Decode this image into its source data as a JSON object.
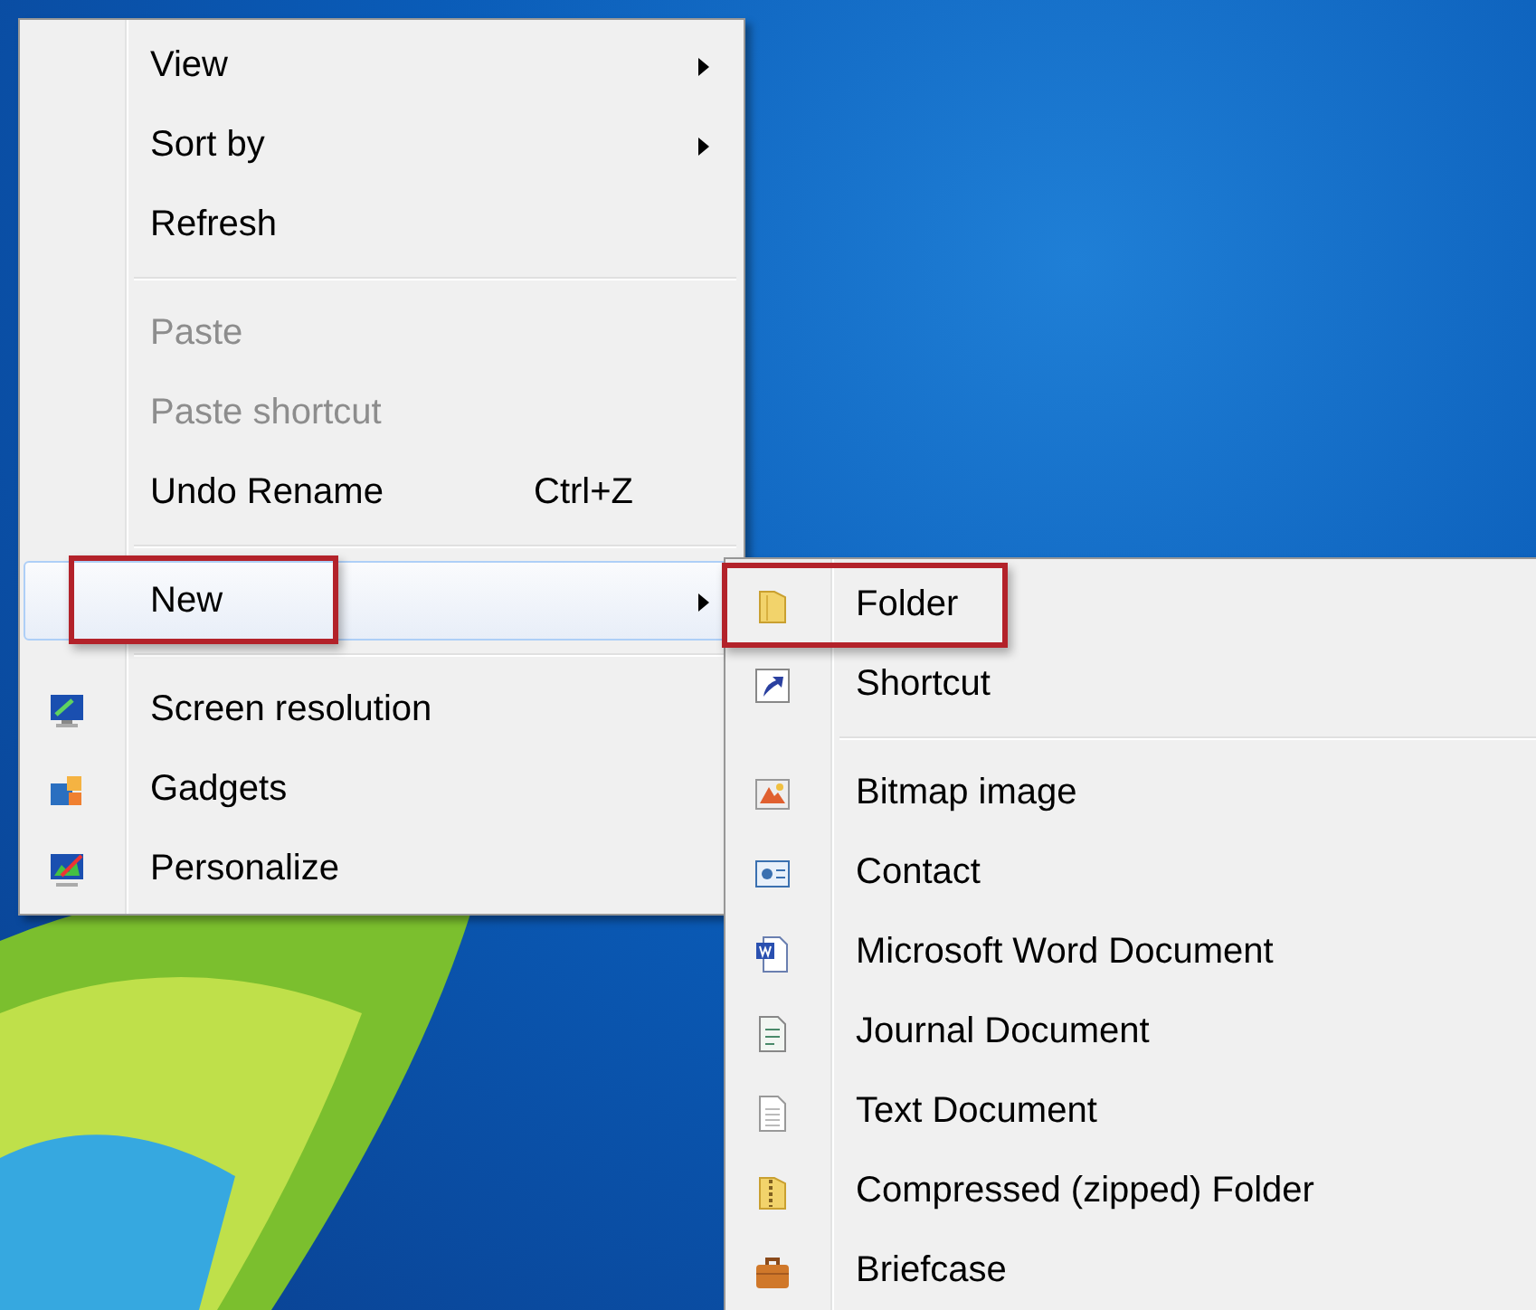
{
  "context_menu": {
    "items": [
      {
        "kind": "item",
        "label": "View",
        "submenu": true,
        "disabled": false,
        "selected": false,
        "marked": false
      },
      {
        "kind": "item",
        "label": "Sort by",
        "submenu": true,
        "disabled": false,
        "selected": false,
        "marked": false
      },
      {
        "kind": "item",
        "label": "Refresh",
        "submenu": false,
        "disabled": false,
        "selected": false,
        "marked": false
      },
      {
        "kind": "separator"
      },
      {
        "kind": "item",
        "label": "Paste",
        "submenu": false,
        "disabled": true,
        "selected": false,
        "marked": false
      },
      {
        "kind": "item",
        "label": "Paste shortcut",
        "submenu": false,
        "disabled": true,
        "selected": false,
        "marked": false
      },
      {
        "kind": "item",
        "label": "Undo Rename",
        "shortcut": "Ctrl+Z",
        "submenu": false,
        "disabled": false,
        "selected": false,
        "marked": false
      },
      {
        "kind": "separator"
      },
      {
        "kind": "item",
        "label": "New",
        "submenu": true,
        "disabled": false,
        "selected": true,
        "marked": true
      },
      {
        "kind": "separator"
      },
      {
        "kind": "monitor",
        "label": "Screen resolution",
        "submenu": false,
        "disabled": false,
        "selected": false,
        "marked": false
      },
      {
        "kind": "gadgets",
        "label": "Gadgets",
        "submenu": false,
        "disabled": false,
        "selected": false,
        "marked": false
      },
      {
        "kind": "personalize",
        "label": "Personalize",
        "submenu": false,
        "disabled": false,
        "selected": false,
        "marked": false
      }
    ]
  },
  "new_submenu": {
    "items": [
      {
        "kind": "folder",
        "label": "Folder",
        "submenu": false,
        "disabled": false,
        "selected": false,
        "marked": true
      },
      {
        "kind": "shortcut",
        "label": "Shortcut",
        "submenu": false,
        "disabled": false,
        "selected": false,
        "marked": false
      },
      {
        "kind": "separator"
      },
      {
        "kind": "bitmap",
        "label": "Bitmap image",
        "submenu": false,
        "disabled": false,
        "selected": false,
        "marked": false
      },
      {
        "kind": "contact",
        "label": "Contact",
        "submenu": false,
        "disabled": false,
        "selected": false,
        "marked": false
      },
      {
        "kind": "word",
        "label": "Microsoft Word Document",
        "submenu": false,
        "disabled": false,
        "selected": false,
        "marked": false
      },
      {
        "kind": "journal",
        "label": "Journal Document",
        "submenu": false,
        "disabled": false,
        "selected": false,
        "marked": false
      },
      {
        "kind": "text",
        "label": "Text Document",
        "submenu": false,
        "disabled": false,
        "selected": false,
        "marked": false
      },
      {
        "kind": "zip",
        "label": "Compressed (zipped) Folder",
        "submenu": false,
        "disabled": false,
        "selected": false,
        "marked": false
      },
      {
        "kind": "briefcase",
        "label": "Briefcase",
        "submenu": false,
        "disabled": false,
        "selected": false,
        "marked": false
      }
    ]
  }
}
